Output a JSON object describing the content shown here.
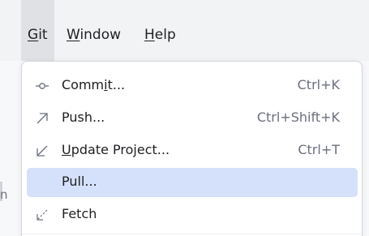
{
  "menubar": {
    "items": [
      {
        "label": "Git",
        "mnemonic": "G",
        "rest": "it",
        "active": true
      },
      {
        "label": "Window",
        "mnemonic": "W",
        "rest": "indow",
        "active": false
      },
      {
        "label": "Help",
        "mnemonic": "H",
        "rest": "elp",
        "active": false
      }
    ]
  },
  "background": {
    "partial_text": "n"
  },
  "git_menu": {
    "items": [
      {
        "icon": "commit-icon",
        "pre": "Comm",
        "mnemonic": "i",
        "post": "t...",
        "shortcut": "Ctrl+K",
        "selected": false
      },
      {
        "icon": "push-arrow-icon",
        "pre": "Push...",
        "mnemonic": "",
        "post": "",
        "shortcut": "Ctrl+Shift+K",
        "selected": false
      },
      {
        "icon": "update-arrow-icon",
        "pre": "",
        "mnemonic": "U",
        "post": "pdate Project...",
        "shortcut": "Ctrl+T",
        "selected": false
      },
      {
        "icon": "",
        "pre": "Pull...",
        "mnemonic": "",
        "post": "",
        "shortcut": "",
        "selected": true
      },
      {
        "icon": "fetch-icon",
        "pre": "Fetch",
        "mnemonic": "",
        "post": "",
        "shortcut": "",
        "selected": false
      }
    ]
  },
  "colors": {
    "selection": "#d5e1fb",
    "active_menu": "#dfe1e5",
    "shortcut_text": "#6c707e"
  }
}
